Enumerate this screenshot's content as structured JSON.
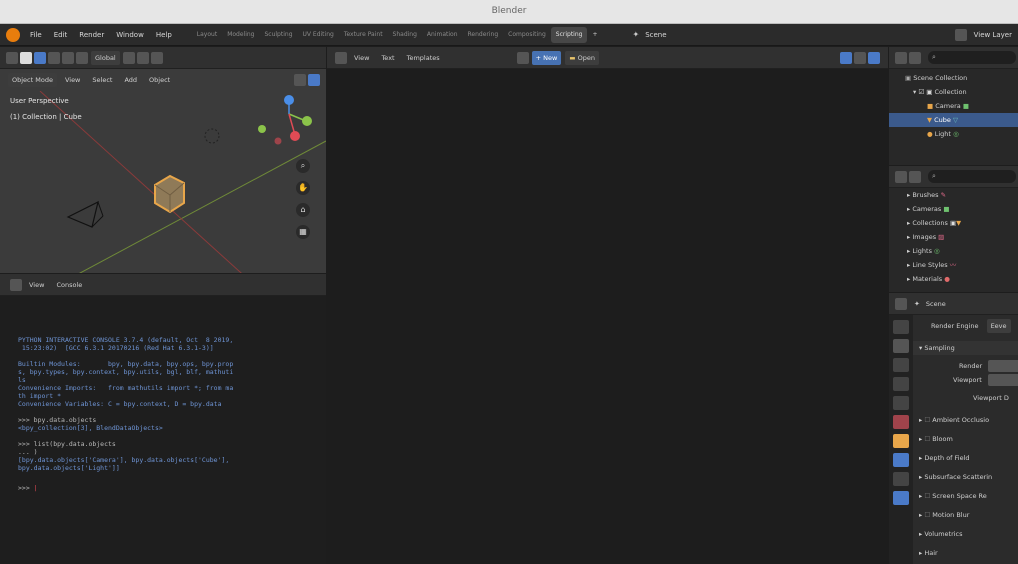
{
  "window": {
    "title": "Blender"
  },
  "menu": [
    "File",
    "Edit",
    "Render",
    "Window",
    "Help"
  ],
  "workspaces": [
    "Layout",
    "Modeling",
    "Sculpting",
    "UV Editing",
    "Texture Paint",
    "Shading",
    "Animation",
    "Rendering",
    "Compositing",
    "Scripting"
  ],
  "add_workspace": "+",
  "scene_selector": "Scene",
  "view_layer": "View Layer",
  "viewport": {
    "transform": "Global",
    "mode": "Object Mode",
    "menus": [
      "View",
      "Select",
      "Add",
      "Object"
    ],
    "overlay_line1": "User Perspective",
    "overlay_line2": "(1) Collection | Cube",
    "gizmo": {
      "x": "X",
      "y": "Y",
      "z": "Z"
    }
  },
  "text_editor": {
    "menus": [
      "View",
      "Text",
      "Templates"
    ],
    "new_label": "New",
    "open_label": "Open"
  },
  "console": {
    "menus": [
      "View",
      "Console"
    ],
    "banner": "PYTHON INTERACTIVE CONSOLE 3.7.4 (default, Oct  8 2019,\n 15:23:02)  [GCC 6.3.1 20170216 (Red Hat 6.3.1-3)]",
    "builtins": "Builtin Modules:       bpy, bpy.data, bpy.ops, bpy.prop\ns, bpy.types, bpy.context, bpy.utils, bgl, blf, mathuti\nls\nConvenience Imports:   from mathutils import *; from ma\nth import *\nConvenience Variables: C = bpy.context, D = bpy.data",
    "cmd1": ">>> bpy.data.objects",
    "out1": "<bpy_collection[3], BlendDataObjects>",
    "cmd2": ">>> list(bpy.data.objects",
    "cont2": "... )",
    "out2": "[bpy.data.objects['Camera'], bpy.data.objects['Cube'],\nbpy.data.objects['Light']]",
    "prompt": ">>> "
  },
  "outliner": {
    "items": [
      {
        "label": "Scene Collection",
        "indent": 0
      },
      {
        "label": "Collection",
        "indent": 1
      },
      {
        "label": "Camera",
        "indent": 2
      },
      {
        "label": "Cube",
        "indent": 2,
        "selected": true
      },
      {
        "label": "Light",
        "indent": 2
      }
    ]
  },
  "data_browser": {
    "items": [
      "Brushes",
      "Cameras",
      "Collections",
      "Images",
      "Lights",
      "Line Styles",
      "Materials"
    ]
  },
  "properties": {
    "scene_label": "Scene",
    "render_engine_label": "Render Engine",
    "render_engine_value": "Eeve",
    "sampling": "Sampling",
    "render": "Render",
    "viewport": "Viewport",
    "viewport_denoise": "Viewport D",
    "panels": [
      "Ambient Occlusio",
      "Bloom",
      "Depth of Field",
      "Subsurface Scatterin",
      "Screen Space Re",
      "Motion Blur",
      "Volumetrics",
      "Hair"
    ]
  },
  "colors": {
    "accent_blue": "#4772b3",
    "selection": "#3b5a8c",
    "console_text": "#6f95d6",
    "cube_orange": "#e8a64a",
    "axis_x": "#e04b55",
    "axis_y": "#8bc34a",
    "axis_z": "#4a8ee8"
  }
}
